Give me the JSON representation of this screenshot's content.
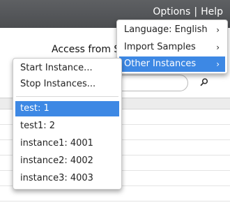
{
  "topnav": {
    "options_label": "Options",
    "separator": "|",
    "help_label": "Help"
  },
  "page": {
    "access_label": "Access from S"
  },
  "right_menu": {
    "items": [
      {
        "label": "Language: English",
        "has_submenu": true
      },
      {
        "label": "Import Samples",
        "has_submenu": true
      },
      {
        "label": "Other Instances",
        "has_submenu": true,
        "selected": true
      }
    ]
  },
  "left_menu": {
    "actions": [
      {
        "label": "Start Instance..."
      },
      {
        "label": "Stop Instances..."
      }
    ],
    "instances": [
      {
        "label": "test: 1",
        "selected": true
      },
      {
        "label": "test1: 2"
      },
      {
        "label": "instance1: 4001"
      },
      {
        "label": "instance2: 4002"
      },
      {
        "label": "instance3: 4003"
      }
    ]
  },
  "icons": {
    "search": "search-icon",
    "submenu_arrow": "chevron-right-icon"
  },
  "colors": {
    "topbar": "#55575a",
    "selection": "#3d88e4",
    "menu_bg": "#ffffff"
  }
}
